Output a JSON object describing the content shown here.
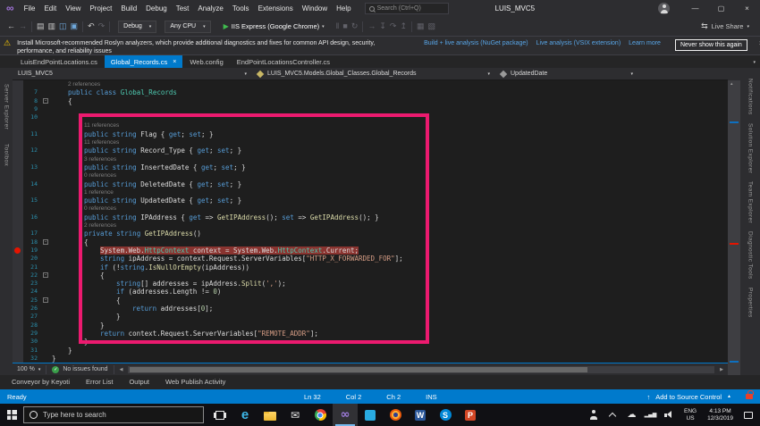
{
  "colors": {
    "accent_blue": "#007ACC",
    "annotation_pink": "#EC1A6F",
    "breakpoint_red": "#E51400",
    "editor_background": "#1E1E1E",
    "chrome_background": "#2D2D30"
  },
  "glyphs": {
    "play": "▶",
    "chevron_down": "▾",
    "close": "×",
    "warning": "⚠",
    "check": "✓",
    "upload_arrow": "↑",
    "solid_up": "▲",
    "scroll_left": "◀",
    "scroll_right": "▶",
    "scroll_up": "▴"
  },
  "title_bar": {
    "menus": [
      "File",
      "Edit",
      "View",
      "Project",
      "Build",
      "Debug",
      "Test",
      "Analyze",
      "Tools",
      "Extensions",
      "Window",
      "Help"
    ],
    "search_placeholder": "Search (Ctrl+Q)",
    "window_title": "LUIS_MVC5",
    "window_controls": [
      {
        "name": "minimize-button",
        "glyph": "—"
      },
      {
        "name": "maximize-button",
        "glyph": "▢"
      },
      {
        "name": "close-button",
        "glyph": "×"
      }
    ]
  },
  "toolbar": {
    "icons_left": [
      {
        "name": "navigate-back-icon",
        "glyph": "←"
      },
      {
        "name": "navigate-forward-icon",
        "glyph": "→",
        "dim": true
      },
      {
        "sep": true
      },
      {
        "name": "new-project-icon",
        "glyph": "▤"
      },
      {
        "name": "open-file-icon",
        "glyph": "▥"
      },
      {
        "name": "save-icon",
        "glyph": "◫",
        "blue": true
      },
      {
        "name": "save-all-icon",
        "glyph": "▣",
        "blue": true
      },
      {
        "sep": true
      },
      {
        "name": "undo-icon",
        "glyph": "↶"
      },
      {
        "name": "redo-icon",
        "glyph": "↷",
        "dim": true
      },
      {
        "sep": true
      }
    ],
    "config_label": "Debug",
    "platform_label": "Any CPU",
    "run_label": "IIS Express (Google Chrome)",
    "icons_mid": [
      {
        "name": "pause-icon",
        "glyph": "‖",
        "dim": true
      },
      {
        "name": "stop-icon",
        "glyph": "■",
        "dim": true
      },
      {
        "name": "restart-icon",
        "glyph": "↻",
        "dim": true
      },
      {
        "sep": true
      },
      {
        "name": "show-next-statement-icon",
        "glyph": "→",
        "dim": true
      },
      {
        "name": "step-into-icon",
        "glyph": "↧",
        "dim": true
      },
      {
        "name": "step-over-icon",
        "glyph": "↷",
        "dim": true
      },
      {
        "name": "step-out-icon",
        "glyph": "↥",
        "dim": true
      },
      {
        "sep": true
      },
      {
        "name": "find-in-files-icon",
        "glyph": "▦",
        "dim": true
      },
      {
        "name": "test-explorer-icon",
        "glyph": "▧",
        "dim": true
      }
    ],
    "live_share_label": "Live Share"
  },
  "info_bar": {
    "message_line1": "Install Microsoft-recommended Roslyn analyzers, which provide additional diagnostics and fixes for common API design, security,",
    "message_line2": "performance, and reliability issues",
    "links": [
      {
        "label": "Build + live analysis (NuGet package)"
      },
      {
        "label": "Live analysis (VSIX extension)"
      },
      {
        "label": "Learn more"
      }
    ],
    "dismiss_button": "Never show this again"
  },
  "tabs": [
    {
      "label": "LuisEndPointLocations.cs",
      "active": false
    },
    {
      "label": "Global_Records.cs",
      "active": true
    },
    {
      "label": "Web.config",
      "active": false
    },
    {
      "label": "EndPointLocationsController.cs",
      "active": false
    }
  ],
  "nav_bar": {
    "project": {
      "label": "LUIS_MVC5"
    },
    "type": {
      "label": "LUIS_MVC5.Models.Global_Classes.Global_Records"
    },
    "member": {
      "label": "UpdatedDate"
    }
  },
  "left_tool_tabs": [
    {
      "label": "Server Explorer"
    },
    {
      "label": "Toolbox"
    }
  ],
  "right_tool_tabs": [
    {
      "label": "Notifications"
    },
    {
      "label": "Solution Explorer"
    },
    {
      "label": "Team Explorer"
    },
    {
      "label": "Diagnostic Tools"
    },
    {
      "label": "Properties"
    }
  ],
  "editor": {
    "breakpoint_line": 19,
    "lines": [
      {
        "n": 7,
        "cl": "2 references",
        "ind": 1,
        "t": [
          [
            "k",
            "public "
          ],
          [
            "k",
            "class "
          ],
          [
            "t",
            "Global_Records"
          ]
        ]
      },
      {
        "n": 8,
        "ind": 1,
        "box": true,
        "t": [
          [
            "p",
            "{"
          ]
        ]
      },
      {
        "n": 9,
        "ind": 1,
        "t": []
      },
      {
        "n": 10,
        "ind": 1,
        "t": []
      },
      {
        "n": 11,
        "cl": "11 references",
        "ind": 2,
        "t": [
          [
            "k",
            "public "
          ],
          [
            "k",
            "string "
          ],
          [
            "p",
            "Flag { "
          ],
          [
            "k",
            "get"
          ],
          [
            "p",
            "; "
          ],
          [
            "k",
            "set"
          ],
          [
            "p",
            "; }"
          ]
        ]
      },
      {
        "n": 12,
        "cl": "11 references",
        "ind": 2,
        "t": [
          [
            "k",
            "public "
          ],
          [
            "k",
            "string "
          ],
          [
            "p",
            "Record_Type { "
          ],
          [
            "k",
            "get"
          ],
          [
            "p",
            "; "
          ],
          [
            "k",
            "set"
          ],
          [
            "p",
            "; }"
          ]
        ]
      },
      {
        "n": 13,
        "cl": "3 references",
        "ind": 2,
        "t": [
          [
            "k",
            "public "
          ],
          [
            "k",
            "string "
          ],
          [
            "p",
            "InsertedDate { "
          ],
          [
            "k",
            "get"
          ],
          [
            "p",
            "; "
          ],
          [
            "k",
            "set"
          ],
          [
            "p",
            "; }"
          ]
        ]
      },
      {
        "n": 14,
        "cl": "0 references",
        "ind": 2,
        "t": [
          [
            "k",
            "public "
          ],
          [
            "k",
            "string "
          ],
          [
            "p",
            "DeletedDate { "
          ],
          [
            "k",
            "get"
          ],
          [
            "p",
            "; "
          ],
          [
            "k",
            "set"
          ],
          [
            "p",
            "; }"
          ]
        ]
      },
      {
        "n": 15,
        "cl": "1 reference",
        "ind": 2,
        "t": [
          [
            "k",
            "public "
          ],
          [
            "k",
            "string "
          ],
          [
            "p",
            "UpdatedDate { "
          ],
          [
            "k",
            "get"
          ],
          [
            "p",
            "; "
          ],
          [
            "k",
            "set"
          ],
          [
            "p",
            "; }"
          ]
        ]
      },
      {
        "n": 16,
        "cl": "0 references",
        "ind": 2,
        "t": [
          [
            "k",
            "public "
          ],
          [
            "k",
            "string "
          ],
          [
            "p",
            "IPAddress { "
          ],
          [
            "k",
            "get"
          ],
          [
            "p",
            " => "
          ],
          [
            "m",
            "GetIPAddress"
          ],
          [
            "p",
            "(); "
          ],
          [
            "k",
            "set"
          ],
          [
            "p",
            " => "
          ],
          [
            "m",
            "GetIPAddress"
          ],
          [
            "p",
            "(); }"
          ]
        ]
      },
      {
        "n": 17,
        "cl": "2 references",
        "ind": 2,
        "t": [
          [
            "k",
            "private "
          ],
          [
            "k",
            "string "
          ],
          [
            "m",
            "GetIPAddress"
          ],
          [
            "p",
            "()"
          ]
        ]
      },
      {
        "n": 18,
        "ind": 2,
        "box": true,
        "t": [
          [
            "p",
            "{"
          ]
        ]
      },
      {
        "n": 19,
        "ind": 3,
        "bp": true,
        "hl": true,
        "t": [
          [
            "p",
            "System.Web."
          ],
          [
            "t",
            "HttpContext"
          ],
          [
            "p",
            " context = "
          ],
          [
            "p",
            "System.Web."
          ],
          [
            "t",
            "HttpContext"
          ],
          [
            "p",
            ".Current;"
          ]
        ]
      },
      {
        "n": 20,
        "ind": 3,
        "t": [
          [
            "k",
            "string "
          ],
          [
            "p",
            "ipAddress = context.Request.ServerVariables["
          ],
          [
            "s",
            "\"HTTP_X_FORWARDED_FOR\""
          ],
          [
            "p",
            "];"
          ]
        ]
      },
      {
        "n": 21,
        "ind": 3,
        "t": [
          [
            "k",
            "if "
          ],
          [
            "p",
            "(!"
          ],
          [
            "k",
            "string"
          ],
          [
            "p",
            "."
          ],
          [
            "m",
            "IsNullOrEmpty"
          ],
          [
            "p",
            "(ipAddress))"
          ]
        ]
      },
      {
        "n": 22,
        "ind": 3,
        "box": true,
        "t": [
          [
            "p",
            "{"
          ]
        ]
      },
      {
        "n": 23,
        "ind": 4,
        "t": [
          [
            "k",
            "string"
          ],
          [
            "p",
            "[] addresses = ipAddress."
          ],
          [
            "m",
            "Split"
          ],
          [
            "p",
            "("
          ],
          [
            "s",
            "','"
          ],
          [
            "p",
            ");"
          ]
        ]
      },
      {
        "n": 24,
        "ind": 4,
        "t": [
          [
            "k",
            "if "
          ],
          [
            "p",
            "(addresses.Length != "
          ],
          [
            "num",
            "0"
          ],
          [
            "p",
            ")"
          ]
        ]
      },
      {
        "n": 25,
        "ind": 4,
        "box": true,
        "t": [
          [
            "p",
            "{"
          ]
        ]
      },
      {
        "n": 26,
        "ind": 5,
        "t": [
          [
            "k",
            "return "
          ],
          [
            "p",
            "addresses["
          ],
          [
            "num",
            "0"
          ],
          [
            "p",
            "];"
          ]
        ]
      },
      {
        "n": 27,
        "ind": 4,
        "t": [
          [
            "p",
            "}"
          ]
        ]
      },
      {
        "n": 28,
        "ind": 3,
        "t": [
          [
            "p",
            "}"
          ]
        ]
      },
      {
        "n": 29,
        "ind": 3,
        "t": [
          [
            "k",
            "return "
          ],
          [
            "p",
            "context.Request.ServerVariables["
          ],
          [
            "s",
            "\"REMOTE_ADDR\""
          ],
          [
            "p",
            "];"
          ]
        ]
      },
      {
        "n": 30,
        "ind": 2,
        "t": [
          [
            "p",
            "}"
          ]
        ]
      },
      {
        "n": 31,
        "ind": 1,
        "t": [
          [
            "p",
            "}"
          ]
        ]
      },
      {
        "n": 32,
        "ind": 0,
        "t": [
          [
            "p",
            "}"
          ]
        ]
      }
    ]
  },
  "editor_status": {
    "zoom": "100 %",
    "issues_label": "No issues found"
  },
  "bottom_tabs": [
    {
      "label": "Conveyor by Keyoti"
    },
    {
      "label": "Error List"
    },
    {
      "label": "Output"
    },
    {
      "label": "Web Publish Activity"
    }
  ],
  "status_bar": {
    "state_label": "Ready",
    "line": "Ln 32",
    "column": "Col 2",
    "character": "Ch 2",
    "insert_mode": "INS",
    "source_control_label": "Add to Source Control"
  },
  "taskbar": {
    "search_placeholder": "Type here to search",
    "apps": [
      {
        "name": "taskbar-task-view-button",
        "icon": "taskview"
      },
      {
        "name": "taskbar-edge-button",
        "icon": "edge"
      },
      {
        "name": "taskbar-file-explorer-button",
        "icon": "folder"
      },
      {
        "name": "taskbar-mail-button",
        "icon": "mail"
      },
      {
        "name": "taskbar-chrome-button",
        "icon": "chrome"
      },
      {
        "name": "taskbar-visual-studio-button",
        "icon": "vs",
        "active": true
      },
      {
        "name": "taskbar-vscode-button",
        "icon": "appblue"
      },
      {
        "name": "taskbar-firefox-button",
        "icon": "firefox"
      },
      {
        "name": "taskbar-word-button",
        "icon": "word"
      },
      {
        "name": "taskbar-skype-button",
        "icon": "skype"
      },
      {
        "name": "taskbar-powerpoint-button",
        "icon": "powerpoint"
      }
    ],
    "tray_icons": [
      {
        "name": "people-icon",
        "cls": "tray-people"
      },
      {
        "name": "hidden-icons-chevron",
        "cls": "tray-chevron"
      },
      {
        "name": "onedrive-icon",
        "cls": "tray-cloud"
      },
      {
        "name": "network-icon",
        "cls": "tray-network"
      },
      {
        "name": "volume-icon",
        "cls": "tray-volume"
      }
    ],
    "tray": {
      "language": "ENG",
      "region": "US",
      "time": "4:13 PM",
      "date": "12/3/2019"
    }
  }
}
